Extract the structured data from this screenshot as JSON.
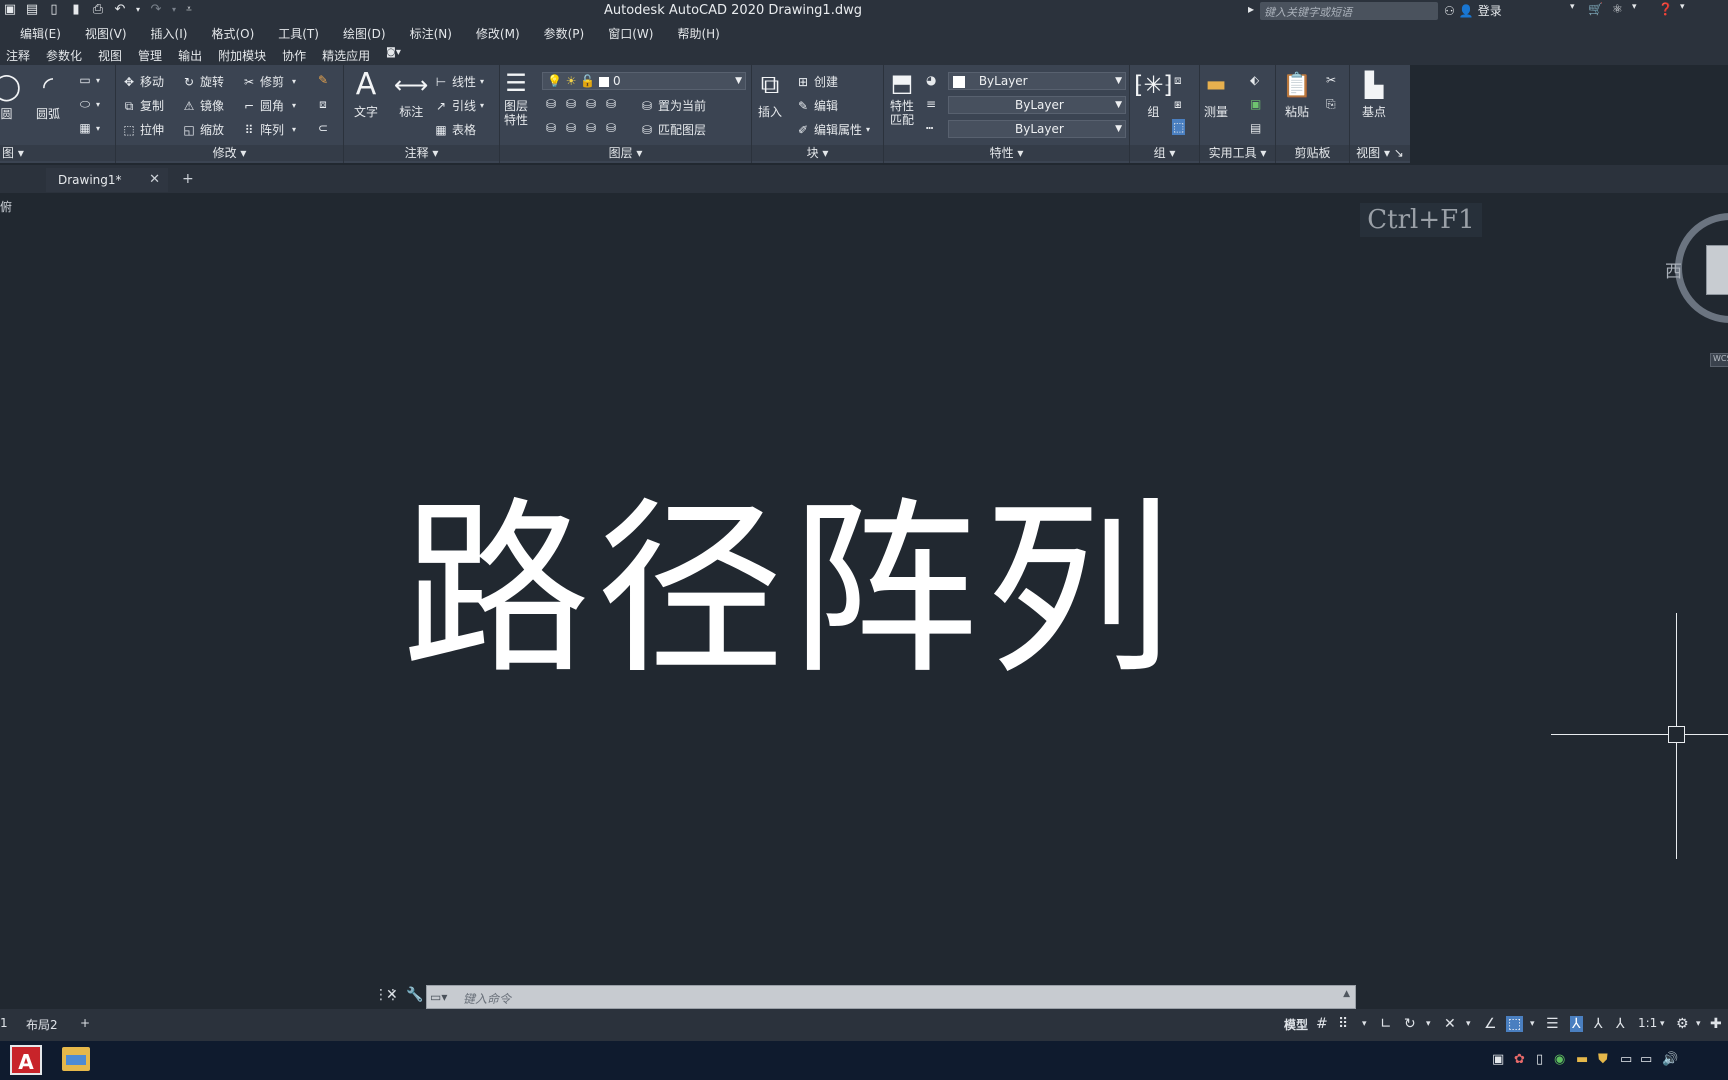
{
  "window": {
    "title": "Autodesk AutoCAD 2020    Drawing1.dwg",
    "search_placeholder": "键入关键字或短语",
    "login": "登录"
  },
  "menu": [
    "编辑(E)",
    "视图(V)",
    "插入(I)",
    "格式(O)",
    "工具(T)",
    "绘图(D)",
    "标注(N)",
    "修改(M)",
    "参数(P)",
    "窗口(W)",
    "帮助(H)"
  ],
  "ribbon_tabs": [
    "注释",
    "参数化",
    "视图",
    "管理",
    "输出",
    "附加模块",
    "协作",
    "精选应用"
  ],
  "ribbon": {
    "draw": {
      "circle": "圆",
      "arc": "圆弧",
      "title": "图"
    },
    "modify": {
      "title": "修改",
      "move": "移动",
      "rotate": "旋转",
      "trim": "修剪",
      "copy": "复制",
      "mirror": "镜像",
      "fillet": "圆角",
      "stretch": "拉伸",
      "scale": "缩放",
      "array": "阵列"
    },
    "annotation": {
      "title": "注释",
      "text": "文字",
      "dimension": "标注",
      "linear": "线性",
      "leader": "引线",
      "table": "表格"
    },
    "layers": {
      "title": "图层",
      "properties_line1": "图层",
      "properties_line2": "特性",
      "current_layer": "0",
      "set_current": "置为当前",
      "match_layer": "匹配图层"
    },
    "block": {
      "title": "块",
      "insert": "插入",
      "create": "创建",
      "edit": "编辑",
      "edit_attributes": "编辑属性"
    },
    "properties": {
      "title": "特性",
      "match_line1": "特性",
      "match_line2": "匹配",
      "color": "ByLayer",
      "linetype": "ByLayer",
      "lineweight": "ByLayer"
    },
    "groups": {
      "title": "组",
      "group": "组"
    },
    "utilities": {
      "title": "实用工具",
      "measure": "测量"
    },
    "clipboard": {
      "title": "剪贴板",
      "paste": "粘贴"
    },
    "view": {
      "title": "视图",
      "base": "基点"
    }
  },
  "doc_tab": {
    "name": "Drawing1*"
  },
  "canvas": {
    "viewport_label": "俯",
    "tooltip": "Ctrl+F1",
    "drawing_text": "路径阵列",
    "viewcube_west": "西",
    "wcs_label": "WCS"
  },
  "command": {
    "placeholder": "键入命令"
  },
  "status": {
    "layout_1": "1",
    "layout_2": "布局2",
    "model": "模型",
    "scale": "1:1"
  }
}
